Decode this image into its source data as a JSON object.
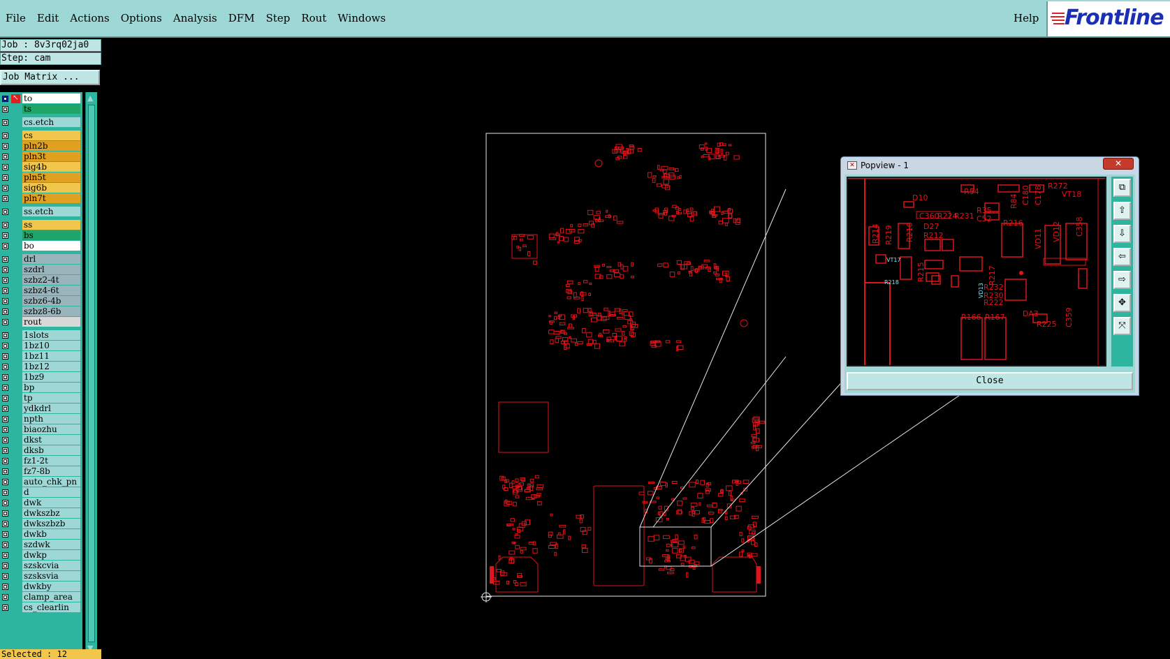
{
  "menubar": {
    "items": [
      "File",
      "Edit",
      "Actions",
      "Options",
      "Analysis",
      "DFM",
      "Step",
      "Rout",
      "Windows"
    ],
    "help": "Help",
    "logo": "Frontline"
  },
  "job": {
    "job_line": "Job : 8v3rq02ja0",
    "step_line": "Step: cam",
    "matrix_button": "Job Matrix ..."
  },
  "layers": [
    {
      "name": "to",
      "color": "#ffffff",
      "special": true
    },
    {
      "name": "ts",
      "color": "#1fa56a"
    },
    {
      "name": "cs.etch",
      "color": "#9ed8d6"
    },
    {
      "name": "cs",
      "color": "#f2c64a"
    },
    {
      "name": "pln2b",
      "color": "#e0a020"
    },
    {
      "name": "pln3t",
      "color": "#e0a020"
    },
    {
      "name": "sig4b",
      "color": "#f2c64a"
    },
    {
      "name": "pln5t",
      "color": "#e0a020"
    },
    {
      "name": "sig6b",
      "color": "#f2c64a"
    },
    {
      "name": "pln7t",
      "color": "#e0a020"
    },
    {
      "name": "ss.etch",
      "color": "#9ed8d6"
    },
    {
      "name": "ss",
      "color": "#f2c64a"
    },
    {
      "name": "bs",
      "color": "#1fa56a"
    },
    {
      "name": "bo",
      "color": "#ffffff"
    },
    {
      "name": "drl",
      "color": "#9ab4bc"
    },
    {
      "name": "szdrl",
      "color": "#9ab4bc"
    },
    {
      "name": "szbz2-4t",
      "color": "#9ab4bc"
    },
    {
      "name": "szbz4-6t",
      "color": "#9ab4bc"
    },
    {
      "name": "szbz6-4b",
      "color": "#9ab4bc"
    },
    {
      "name": "szbz8-6b",
      "color": "#9ab4bc"
    },
    {
      "name": "rout",
      "color": "#d8d8d8"
    },
    {
      "name": "1slots",
      "color": "#9ed8d6"
    },
    {
      "name": "1bz10",
      "color": "#9ed8d6"
    },
    {
      "name": "1bz11",
      "color": "#9ed8d6"
    },
    {
      "name": "1bz12",
      "color": "#9ed8d6"
    },
    {
      "name": "1bz9",
      "color": "#9ed8d6"
    },
    {
      "name": "bp",
      "color": "#9ed8d6"
    },
    {
      "name": "tp",
      "color": "#9ed8d6"
    },
    {
      "name": "ydkdrl",
      "color": "#9ed8d6"
    },
    {
      "name": "npth",
      "color": "#9ed8d6"
    },
    {
      "name": "biaozhu",
      "color": "#9ed8d6"
    },
    {
      "name": "dkst",
      "color": "#9ed8d6"
    },
    {
      "name": "dksb",
      "color": "#9ed8d6"
    },
    {
      "name": "fz1-2t",
      "color": "#9ed8d6"
    },
    {
      "name": "fz7-8b",
      "color": "#9ed8d6"
    },
    {
      "name": "auto_chk_pn",
      "color": "#9ed8d6"
    },
    {
      "name": "d",
      "color": "#9ed8d6"
    },
    {
      "name": "dwk",
      "color": "#9ed8d6"
    },
    {
      "name": "dwkszbz",
      "color": "#9ed8d6"
    },
    {
      "name": "dwkszbzb",
      "color": "#9ed8d6"
    },
    {
      "name": "dwkb",
      "color": "#9ed8d6"
    },
    {
      "name": "szdwk",
      "color": "#9ed8d6"
    },
    {
      "name": "dwkp",
      "color": "#9ed8d6"
    },
    {
      "name": "szskcvia",
      "color": "#9ed8d6"
    },
    {
      "name": "szsksvia",
      "color": "#9ed8d6"
    },
    {
      "name": "dwkby",
      "color": "#9ed8d6"
    },
    {
      "name": "clamp_area",
      "color": "#9ed8d6"
    },
    {
      "name": "cs_clearlin",
      "color": "#9ed8d6"
    }
  ],
  "status": {
    "selected": "Selected : 12"
  },
  "popview": {
    "title": "Popview - 1",
    "close_button": "Close",
    "labels": [
      "D10",
      "R54",
      "R84",
      "C180",
      "C178",
      "R272",
      "VT18",
      "R214",
      "R219",
      "R210",
      "C360",
      "R224",
      "R231",
      "R35",
      "C52",
      "R216",
      "VD11",
      "VD12",
      "C358",
      "D27",
      "R212",
      "VT17",
      "R215",
      "R217",
      "R218",
      "VD13",
      "R232",
      "R230",
      "R222",
      "C359",
      "DA3",
      "R225",
      "R166",
      "R167"
    ]
  },
  "colors": {
    "board": "#e0141a",
    "ui_teal": "#9ed8d6",
    "list_bg": "#2db5a0"
  }
}
